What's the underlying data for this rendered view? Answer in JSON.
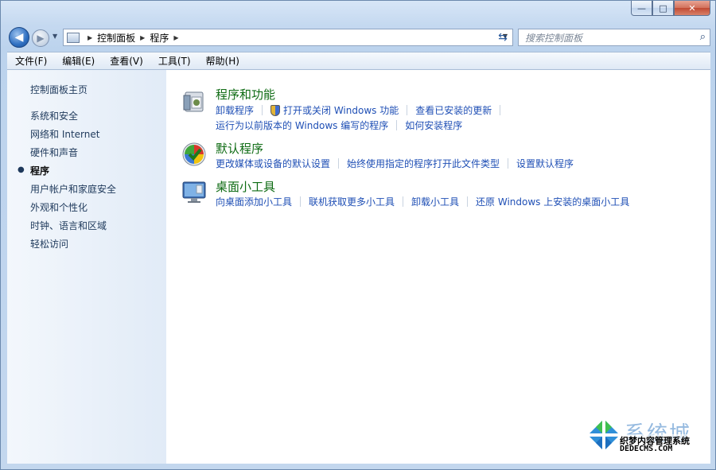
{
  "window": {
    "caption_buttons": {
      "minimize": "—",
      "maximize": "□",
      "close": "✕"
    }
  },
  "nav": {
    "breadcrumb": [
      "控制面板",
      "程序"
    ],
    "search_placeholder": "搜索控制面板"
  },
  "menubar": [
    "文件(F)",
    "编辑(E)",
    "查看(V)",
    "工具(T)",
    "帮助(H)"
  ],
  "sidebar": {
    "home": "控制面板主页",
    "items": [
      {
        "label": "系统和安全",
        "active": false
      },
      {
        "label": "网络和 Internet",
        "active": false
      },
      {
        "label": "硬件和声音",
        "active": false
      },
      {
        "label": "程序",
        "active": true
      },
      {
        "label": "用户帐户和家庭安全",
        "active": false
      },
      {
        "label": "外观和个性化",
        "active": false
      },
      {
        "label": "时钟、语言和区域",
        "active": false
      },
      {
        "label": "轻松访问",
        "active": false
      }
    ]
  },
  "categories": [
    {
      "title": "程序和功能",
      "icon": "programs-features-icon",
      "rows": [
        [
          "卸载程序",
          "打开或关闭 Windows 功能",
          "查看已安装的更新"
        ],
        [
          "运行为以前版本的 Windows 编写的程序",
          "如何安装程序"
        ]
      ]
    },
    {
      "title": "默认程序",
      "icon": "default-programs-icon",
      "rows": [
        [
          "更改媒体或设备的默认设置",
          "始终使用指定的程序打开此文件类型",
          "设置默认程序"
        ]
      ]
    },
    {
      "title": "桌面小工具",
      "icon": "desktop-gadgets-icon",
      "rows": [
        [
          "向桌面添加小工具",
          "联机获取更多小工具",
          "卸载小工具",
          "还原 Windows 上安装的桌面小工具"
        ]
      ]
    }
  ],
  "watermark": {
    "line1": "系统城",
    "line2": "织梦内容管理系统",
    "line3": "DEDECMS.COM"
  }
}
